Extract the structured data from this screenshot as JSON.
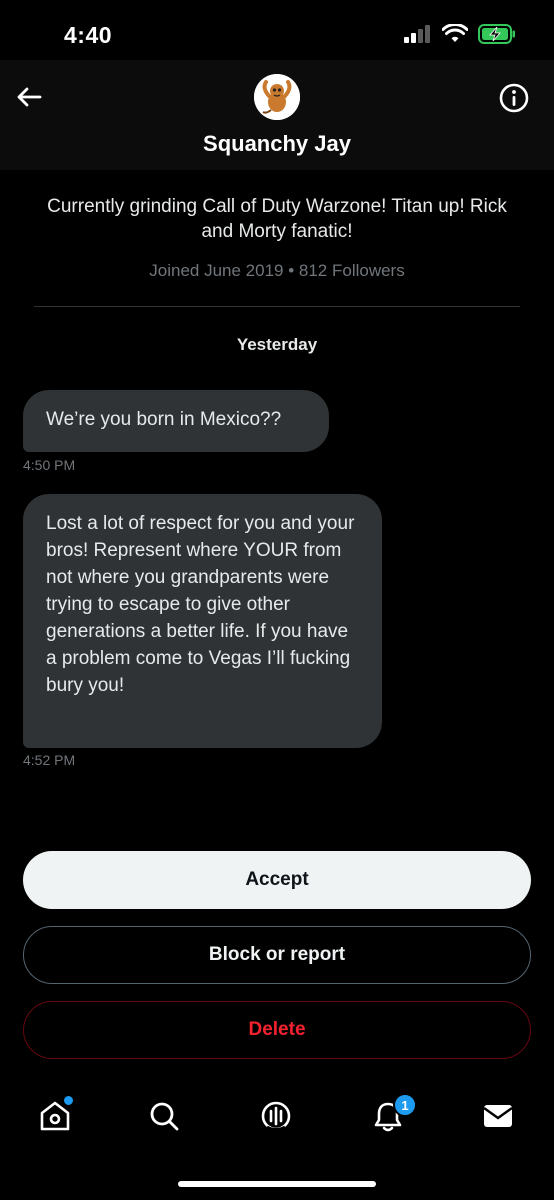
{
  "status_bar": {
    "time": "4:40"
  },
  "header": {
    "display_name": "Squanchy Jay"
  },
  "profile": {
    "bio": "Currently grinding Call of Duty Warzone! Titan up! Rick and Morty fanatic!",
    "meta": "Joined June 2019 • 812 Followers"
  },
  "conversation": {
    "date_separator": "Yesterday",
    "messages": [
      {
        "text": "We’re you born in Mexico??",
        "time": "4:50 PM"
      },
      {
        "text": "Lost a lot of respect for you and your bros! Represent where YOUR from not where you grandparents were trying to escape to give other generations a better life. If you have a problem come to Vegas I’ll fucking bury you!",
        "time": "4:52 PM"
      }
    ]
  },
  "actions": {
    "accept": "Accept",
    "block_or_report": "Block or report",
    "delete": "Delete"
  },
  "tab_bar": {
    "items": [
      {
        "icon": "home-icon"
      },
      {
        "icon": "search-icon"
      },
      {
        "icon": "spaces-icon"
      },
      {
        "icon": "notifications-icon"
      },
      {
        "icon": "messages-icon"
      }
    ],
    "notification_count": "1"
  },
  "colors": {
    "accent": "#1d9bf0",
    "danger": "#f4212e",
    "bubble": "#2f3336",
    "battery": "#34c759"
  }
}
